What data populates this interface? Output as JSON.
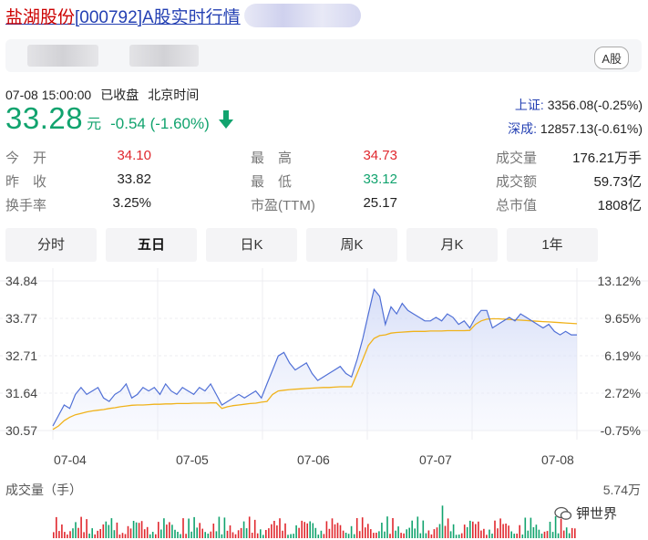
{
  "header": {
    "name": "盐湖股份",
    "code": "[000792]",
    "suffix": "A股实时行情",
    "badge": "A股"
  },
  "quote": {
    "datetime": "07-08 15:00:00",
    "status": "已收盘",
    "timezone": "北京时间",
    "price": "33.28",
    "unit": "元",
    "change": "-0.54 (-1.60%)"
  },
  "indices": [
    {
      "name": "上证:",
      "value": "3356.08(-0.25%)"
    },
    {
      "name": "深成:",
      "value": "12857.13(-0.61%)"
    }
  ],
  "stats": [
    {
      "label": "今　开",
      "value": "34.10",
      "tone": "red"
    },
    {
      "label": "最　高",
      "value": "34.73",
      "tone": "red"
    },
    {
      "label": "成交量",
      "value": "176.21万手",
      "tone": "plain"
    },
    {
      "label": "昨　收",
      "value": "33.82",
      "tone": "plain"
    },
    {
      "label": "最　低",
      "value": "33.12",
      "tone": "green"
    },
    {
      "label": "成交额",
      "value": "59.73亿",
      "tone": "plain"
    },
    {
      "label": "换手率",
      "value": "3.25%",
      "tone": "plain"
    },
    {
      "label": "市盈(TTM)",
      "value": "25.17",
      "tone": "plain"
    },
    {
      "label": "总市值",
      "value": "1808亿",
      "tone": "plain"
    }
  ],
  "tabs": [
    "分时",
    "五日",
    "日K",
    "周K",
    "月K",
    "1年"
  ],
  "active_tab": "五日",
  "colors": {
    "up": "#e0282e",
    "down": "#11a36e",
    "line": "#4f6fd6",
    "avg": "#f0b21a",
    "link": "#2440b3"
  },
  "chart_data": {
    "type": "line",
    "title": "",
    "xlabel": "",
    "ylabel": "",
    "ylim": [
      30.57,
      34.84
    ],
    "y_ticks": [
      "34.84",
      "33.77",
      "32.71",
      "31.64",
      "30.57"
    ],
    "pct_ticks": [
      "13.12%",
      "9.65%",
      "6.19%",
      "2.72%",
      "-0.75%"
    ],
    "x_labels": [
      "07-04",
      "07-05",
      "07-06",
      "07-07",
      "07-08"
    ],
    "series": [
      {
        "values": [
          30.7,
          31.0,
          31.3,
          31.2,
          31.6,
          31.8,
          31.6,
          31.7,
          31.8,
          31.5,
          31.4,
          31.6,
          31.7,
          31.9,
          31.5,
          31.6,
          31.8,
          31.7,
          31.8,
          31.6,
          31.9,
          31.7,
          31.6,
          31.8,
          31.7,
          31.6,
          31.8,
          31.7,
          31.9,
          31.6,
          31.3,
          31.4,
          31.5,
          31.6,
          31.5,
          31.6,
          31.7,
          31.5,
          31.9,
          32.3,
          32.7,
          32.8,
          32.5,
          32.3,
          32.4,
          32.5,
          32.2,
          32.0,
          32.1,
          32.2,
          32.3,
          32.4,
          32.2,
          32.1,
          32.6,
          33.2,
          33.9,
          34.6,
          34.4,
          33.6,
          34.1,
          33.9,
          34.2,
          34.0,
          33.9,
          33.8,
          33.7,
          33.7,
          33.8,
          33.7,
          33.9,
          33.8,
          33.6,
          33.7,
          33.5,
          33.8,
          34.0,
          34.0,
          33.5,
          33.6,
          33.7,
          33.8,
          33.7,
          33.9,
          33.8,
          33.7,
          33.6,
          33.5,
          33.6,
          33.4,
          33.3,
          33.4,
          33.3,
          33.3
        ]
      },
      {
        "values": [
          30.6,
          30.7,
          30.85,
          30.95,
          31.02,
          31.06,
          31.1,
          31.13,
          31.15,
          31.17,
          31.2,
          31.22,
          31.25,
          31.27,
          31.29,
          31.3,
          31.3,
          31.31,
          31.32,
          31.32,
          31.33,
          31.33,
          31.34,
          31.34,
          31.34,
          31.35,
          31.35,
          31.35,
          31.36,
          31.36,
          31.2,
          31.25,
          31.28,
          31.3,
          31.32,
          31.34,
          31.35,
          31.38,
          31.4,
          31.6,
          31.7,
          31.72,
          31.74,
          31.75,
          31.76,
          31.77,
          31.78,
          31.79,
          31.8,
          31.8,
          31.81,
          31.82,
          31.82,
          31.82,
          32.2,
          32.6,
          33.0,
          33.2,
          33.28,
          33.3,
          33.35,
          33.37,
          33.38,
          33.39,
          33.4,
          33.4,
          33.4,
          33.41,
          33.41,
          33.41,
          33.42,
          33.42,
          33.42,
          33.42,
          33.43,
          33.6,
          33.7,
          33.75,
          33.76,
          33.76,
          33.75,
          33.74,
          33.73,
          33.72,
          33.71,
          33.7,
          33.69,
          33.68,
          33.67,
          33.66,
          33.65,
          33.64,
          33.63,
          33.62
        ]
      }
    ],
    "volume_max": "5.74万"
  },
  "labels": {
    "volume": "成交量（手）",
    "watermark": "钾世界"
  }
}
